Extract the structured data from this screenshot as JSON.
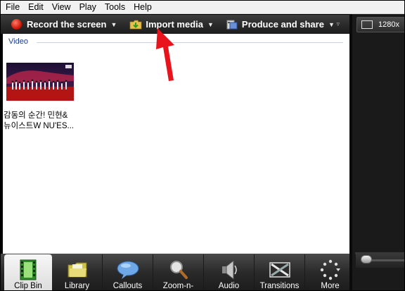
{
  "menu": [
    "File",
    "Edit",
    "View",
    "Play",
    "Tools",
    "Help"
  ],
  "toolbar": {
    "record_label": "Record the screen",
    "import_label": "Import media",
    "produce_label": "Produce and share"
  },
  "preview": {
    "resolution_label": "1280x"
  },
  "clip_bin": {
    "section_label": "Video",
    "clip": {
      "name_line1": "감동의 순간! 민현&",
      "name_line2": "뉴이스트W NU'ES..."
    }
  },
  "tabs": [
    {
      "label": "Clip Bin",
      "icon": "film-strip-icon",
      "active": true
    },
    {
      "label": "Library",
      "icon": "folder-icon",
      "active": false
    },
    {
      "label": "Callouts",
      "icon": "speech-bubble-icon",
      "active": false
    },
    {
      "label": "Zoom-n-",
      "icon": "magnifier-icon",
      "active": false
    },
    {
      "label": "Audio",
      "icon": "speaker-icon",
      "active": false
    },
    {
      "label": "Transitions",
      "icon": "transition-icon",
      "active": false
    },
    {
      "label": "More",
      "icon": "more-dots-icon",
      "active": false
    }
  ],
  "colors": {
    "accent_red": "#e8131b",
    "section_blue": "#1c3d8a",
    "toolbar_bg": "#2a2a2a"
  }
}
